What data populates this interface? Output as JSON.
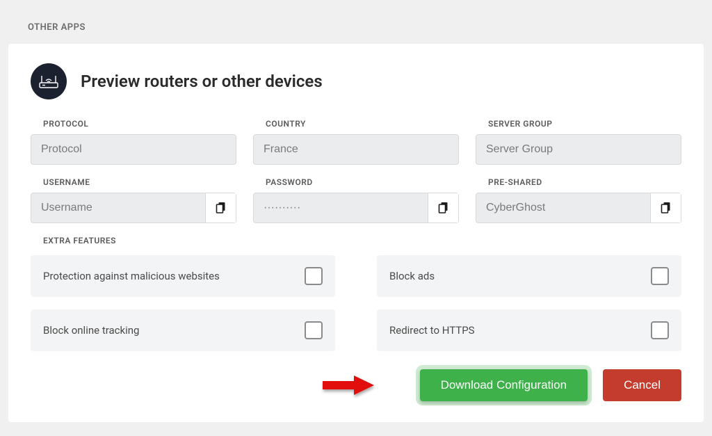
{
  "section_label": "OTHER APPS",
  "card": {
    "title": "Preview routers or other devices"
  },
  "fields": {
    "protocol": {
      "label": "PROTOCOL",
      "placeholder": "Protocol"
    },
    "country": {
      "label": "COUNTRY",
      "value": "France"
    },
    "server_group": {
      "label": "SERVER GROUP",
      "placeholder": "Server Group"
    },
    "username": {
      "label": "USERNAME",
      "placeholder": "Username"
    },
    "password": {
      "label": "PASSWORD",
      "value": "··········"
    },
    "preshared": {
      "label": "PRE-SHARED",
      "value": "CyberGhost"
    }
  },
  "extras": {
    "label": "EXTRA FEATURES",
    "items": {
      "malicious": "Protection against malicious websites",
      "ads": "Block ads",
      "tracking": "Block online tracking",
      "https": "Redirect to HTTPS"
    }
  },
  "buttons": {
    "download": "Download Configuration",
    "cancel": "Cancel"
  }
}
